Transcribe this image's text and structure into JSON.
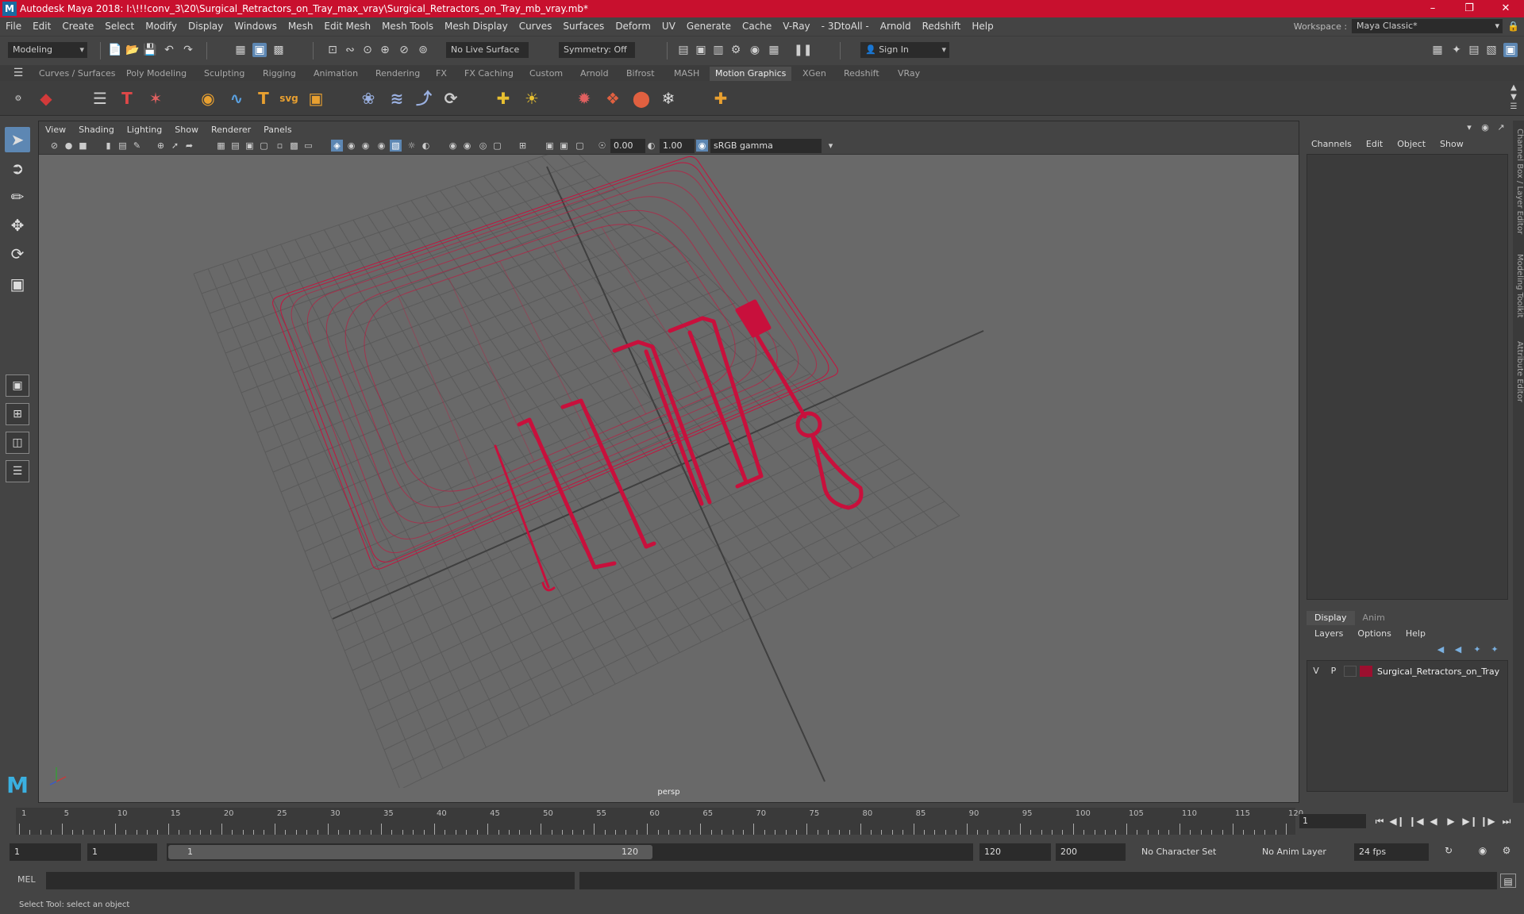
{
  "window": {
    "app_title": "Autodesk Maya 2018: I:\\!!!conv_3\\20\\Surgical_Retractors_on_Tray_max_vray\\Surgical_Retractors_on_Tray_mb_vray.mb*",
    "logo_letter": "M",
    "minimize": "–",
    "maximize": "❐",
    "close": "✕"
  },
  "menubar": {
    "items": [
      "File",
      "Edit",
      "Create",
      "Select",
      "Modify",
      "Display",
      "Windows",
      "Mesh",
      "Edit Mesh",
      "Mesh Tools",
      "Mesh Display",
      "Curves",
      "Surfaces",
      "Deform",
      "UV",
      "Generate",
      "Cache",
      "V-Ray",
      "- 3DtoAll -",
      "Arnold",
      "Redshift",
      "Help"
    ],
    "workspace_label": "Workspace :",
    "workspace_value": "Maya Classic*"
  },
  "statusline": {
    "mode": "Modeling",
    "live_surface": "No Live Surface",
    "symmetry": "Symmetry: Off",
    "sign_in": "Sign In"
  },
  "shelf_tabs": [
    "Curves / Surfaces",
    "Poly Modeling",
    "Sculpting",
    "Rigging",
    "Animation",
    "Rendering",
    "FX",
    "FX Caching",
    "Custom",
    "Arnold",
    "Bifrost",
    "MASH",
    "Motion Graphics",
    "XGen",
    "Redshift",
    "VRay"
  ],
  "active_shelf_tab": "Motion Graphics",
  "shelf_icons": {
    "svg_label": "svg",
    "type_label": "T"
  },
  "viewport": {
    "menu": [
      "View",
      "Shading",
      "Lighting",
      "Show",
      "Renderer",
      "Panels"
    ],
    "exposure": "0.00",
    "gamma": "1.00",
    "color_space": "sRGB gamma",
    "camera_label": "persp",
    "wire_color": "#c8103c"
  },
  "channel_box": {
    "menu": [
      "Channels",
      "Edit",
      "Object",
      "Show"
    ]
  },
  "layer_editor": {
    "tabs": [
      "Display",
      "Anim"
    ],
    "active_tab": "Display",
    "menu": [
      "Layers",
      "Options",
      "Help"
    ],
    "layer": {
      "visible": "V",
      "playback": "P",
      "name": "Surgical_Retractors_on_Tray",
      "color": "#9c0f2f"
    }
  },
  "side_tabs": [
    "Channel Box / Layer Editor",
    "Modeling Toolkit",
    "Attribute Editor"
  ],
  "timeline": {
    "labels": [
      "1",
      "5",
      "10",
      "15",
      "20",
      "25",
      "30",
      "35",
      "40",
      "45",
      "50",
      "55",
      "60",
      "65",
      "70",
      "75",
      "80",
      "85",
      "90",
      "95",
      "100",
      "105",
      "110",
      "115",
      "120"
    ],
    "current_frame": "1"
  },
  "range": {
    "start": "1",
    "playback_start": "1",
    "slider_start": "1",
    "slider_end": "120",
    "playback_end": "120",
    "end": "200",
    "character_set": "No Character Set",
    "anim_layer": "No Anim Layer",
    "fps": "24 fps"
  },
  "command": {
    "language": "MEL",
    "help_text": "Select Tool: select an object"
  }
}
